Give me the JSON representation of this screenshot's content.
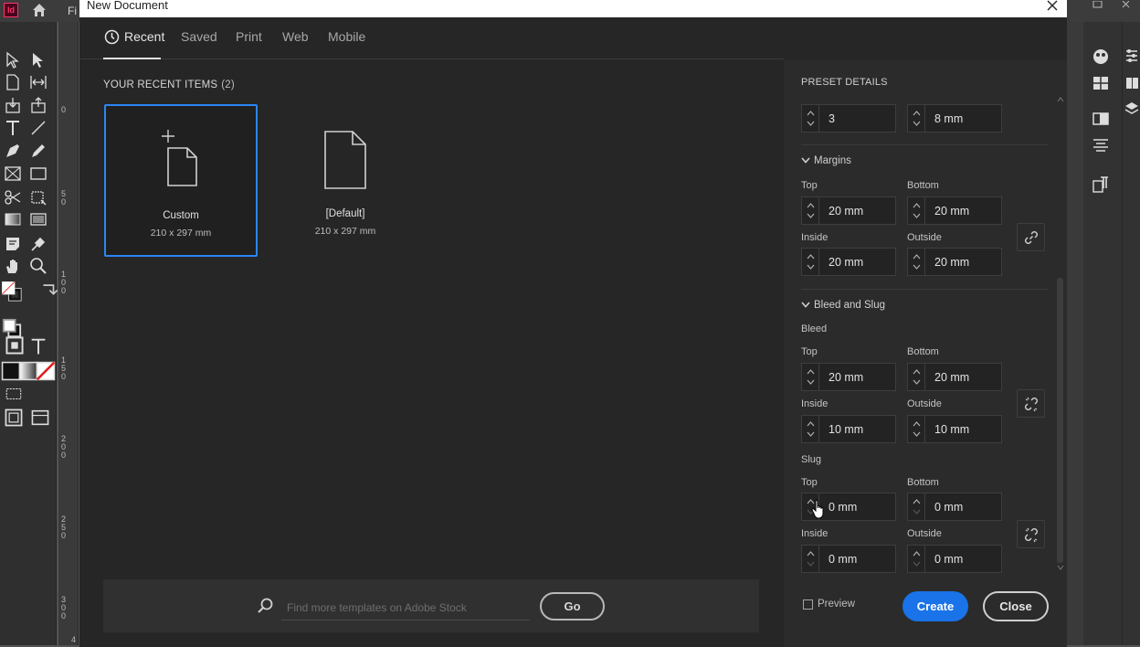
{
  "app": {
    "logo_text": "Id",
    "menu_file": "Fi",
    "ruler_marks": [
      "0",
      "5 0",
      "1 0 0",
      "1 5 0",
      "2 0 0",
      "2 5 0",
      "3 0 0"
    ],
    "ruler_bottom": "4"
  },
  "dialog": {
    "title": "New Document",
    "tabs": [
      {
        "label": "Recent",
        "active": true
      },
      {
        "label": "Saved"
      },
      {
        "label": "Print"
      },
      {
        "label": "Web"
      },
      {
        "label": "Mobile"
      }
    ],
    "recent": {
      "header": "YOUR RECENT ITEMS",
      "count": "(2)",
      "items": [
        {
          "name": "Custom",
          "size": "210 x 297 mm",
          "selected": true
        },
        {
          "name": "[Default]",
          "size": "210 x 297 mm"
        }
      ]
    },
    "stock": {
      "placeholder": "Find more templates on Adobe Stock",
      "go_label": "Go"
    },
    "preset": {
      "title": "PRESET DETAILS",
      "columns_value": "3",
      "gutter_value": "8 mm",
      "margins": {
        "title": "Margins",
        "top_label": "Top",
        "top": "20 mm",
        "bottom_label": "Bottom",
        "bottom": "20 mm",
        "inside_label": "Inside",
        "inside": "20 mm",
        "outside_label": "Outside",
        "outside": "20 mm"
      },
      "bleed_slug": {
        "title": "Bleed and Slug",
        "bleed_label": "Bleed",
        "bleed": {
          "top_label": "Top",
          "top": "20 mm",
          "bottom_label": "Bottom",
          "bottom": "20 mm",
          "inside_label": "Inside",
          "inside": "10 mm",
          "outside_label": "Outside",
          "outside": "10 mm"
        },
        "slug_label": "Slug",
        "slug": {
          "top_label": "Top",
          "top": "0 mm",
          "bottom_label": "Bottom",
          "bottom": "0 mm",
          "inside_label": "Inside",
          "inside": "0 mm",
          "outside_label": "Outside",
          "outside": "0 mm"
        }
      }
    },
    "footer": {
      "preview_label": "Preview",
      "create_label": "Create",
      "close_label": "Close"
    }
  },
  "colors": {
    "accent": "#1a73e8",
    "selection": "#2b86f5",
    "dialog_bg": "#262626",
    "panel_bg": "#2b2b2b"
  }
}
